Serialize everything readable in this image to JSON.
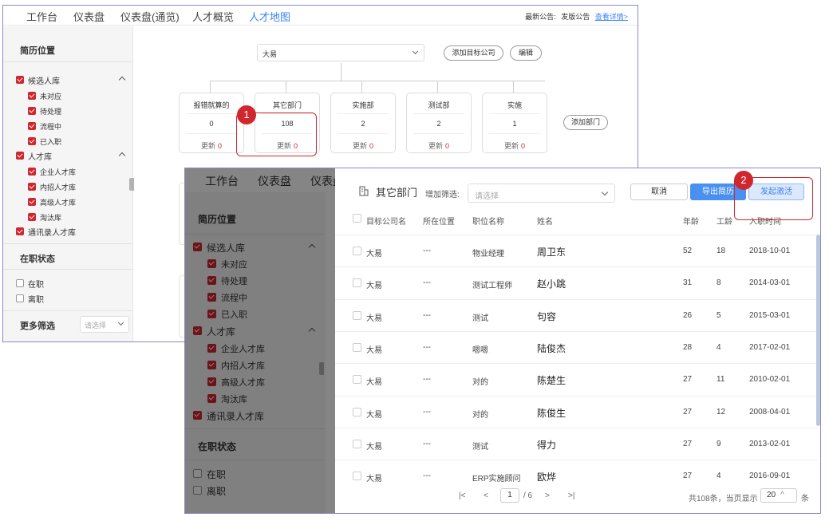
{
  "nav": {
    "tabs": [
      "工作台",
      "仪表盘",
      "仪表盘(通览)",
      "人才概览",
      "人才地图"
    ],
    "active_tab": "人才地图",
    "notice_label": "最新公告:",
    "notice_text": "发版公告",
    "notice_link": "查看详情>"
  },
  "sidebar": {
    "resume_title": "简历位置",
    "candidate_group": "候选人库",
    "candidate_items": [
      "未对应",
      "待处理",
      "流程中",
      "已入职"
    ],
    "talent_group": "人才库",
    "talent_items": [
      "企业人才库",
      "内招人才库",
      "高级人才库",
      "淘汰库"
    ],
    "contacts": "通讯录人才库",
    "status_title": "在职状态",
    "status_items": [
      "在职",
      "离职"
    ],
    "more_title": "更多筛选",
    "more_placeholder": "请选择"
  },
  "talent_map": {
    "company": "大易",
    "add_target_company": "添加目标公司",
    "edit": "编辑",
    "add_department": "添加部门",
    "update_label": "更新",
    "departments": [
      {
        "name": "报错就算的",
        "count": "0",
        "updates": "0"
      },
      {
        "name": "其它部门",
        "count": "108",
        "updates": "0"
      },
      {
        "name": "实施部",
        "count": "2",
        "updates": "0"
      },
      {
        "name": "测试部",
        "count": "2",
        "updates": "0"
      },
      {
        "name": "实施",
        "count": "1",
        "updates": "0"
      }
    ]
  },
  "markers": {
    "one": "1",
    "two": "2"
  },
  "drawer": {
    "title": "其它部门",
    "filter_label": "增加筛选:",
    "filter_placeholder": "请选择",
    "cancel": "取消",
    "export": "导出简历",
    "activate": "发起激活",
    "columns": [
      "目标公司名",
      "所在位置",
      "职位名称",
      "姓名",
      "年龄",
      "工龄",
      "入职时间"
    ],
    "rows": [
      {
        "company": "大易",
        "location": "---",
        "position": "物业经理",
        "name": "周卫东",
        "age": "52",
        "years": "18",
        "joined": "2018-10-01"
      },
      {
        "company": "大易",
        "location": "---",
        "position": "测试工程师",
        "name": "赵小跳",
        "age": "31",
        "years": "8",
        "joined": "2014-03-01"
      },
      {
        "company": "大易",
        "location": "---",
        "position": "测试",
        "name": "句容",
        "age": "26",
        "years": "5",
        "joined": "2015-03-01"
      },
      {
        "company": "大易",
        "location": "---",
        "position": "嗯嗯",
        "name": "陆俊杰",
        "age": "28",
        "years": "4",
        "joined": "2017-02-01"
      },
      {
        "company": "大易",
        "location": "---",
        "position": "对的",
        "name": "陈楚生",
        "age": "27",
        "years": "11",
        "joined": "2010-02-01"
      },
      {
        "company": "大易",
        "location": "---",
        "position": "对的",
        "name": "陈俊生",
        "age": "27",
        "years": "12",
        "joined": "2008-04-01"
      },
      {
        "company": "大易",
        "location": "---",
        "position": "测试",
        "name": "得力",
        "age": "27",
        "years": "9",
        "joined": "2013-02-01"
      },
      {
        "company": "大易",
        "location": "---",
        "position": "ERP实施顾问",
        "name": "欧烨",
        "age": "27",
        "years": "4",
        "joined": "2016-09-01"
      }
    ],
    "pager": {
      "current": "1",
      "total_pages": "/ 6",
      "summary": "共108条，当页显示",
      "page_size": "20",
      "unit": "条"
    }
  },
  "colors": {
    "accent": "#3b82f6",
    "marker": "#d0272f",
    "check": "#d0272f"
  }
}
